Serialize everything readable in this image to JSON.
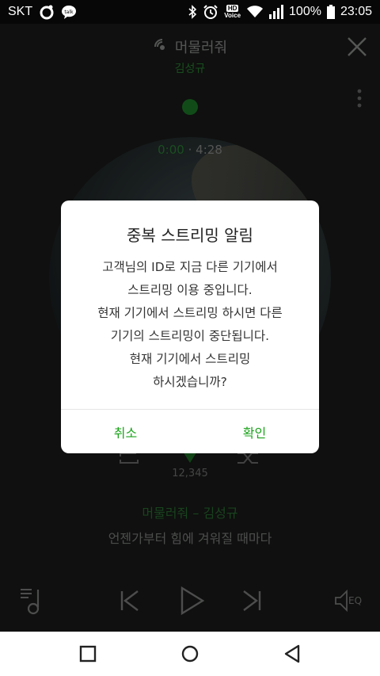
{
  "status": {
    "carrier": "SKT",
    "hd_label_top": "HD",
    "hd_label_bottom": "Voice",
    "battery": "100%",
    "time": "23:05"
  },
  "player": {
    "song_title": "머물러줘",
    "artist": "김성규",
    "time_elapsed": "0:00",
    "time_separator": "·",
    "time_total": "4:28",
    "like_count": "12,345",
    "lyric_title": "머물러줘 – 김성규",
    "lyric_line": "언젠가부터 힘에 겨워질 때마다",
    "eq_label": "EQ"
  },
  "dialog": {
    "title": "중복 스트리밍 알림",
    "body_lines": [
      "고객님의 ID로 지금 다른 기기에서",
      "스트리밍 이용 중입니다.",
      "현재 기기에서 스트리밍 하시면 다른",
      "기기의 스트리밍이 중단됩니다.",
      "현재 기기에서 스트리밍",
      "하시겠습니까?"
    ],
    "cancel_label": "취소",
    "confirm_label": "확인"
  },
  "colors": {
    "accent_green": "#1aa31a",
    "dim_green": "#2f8f3a"
  }
}
